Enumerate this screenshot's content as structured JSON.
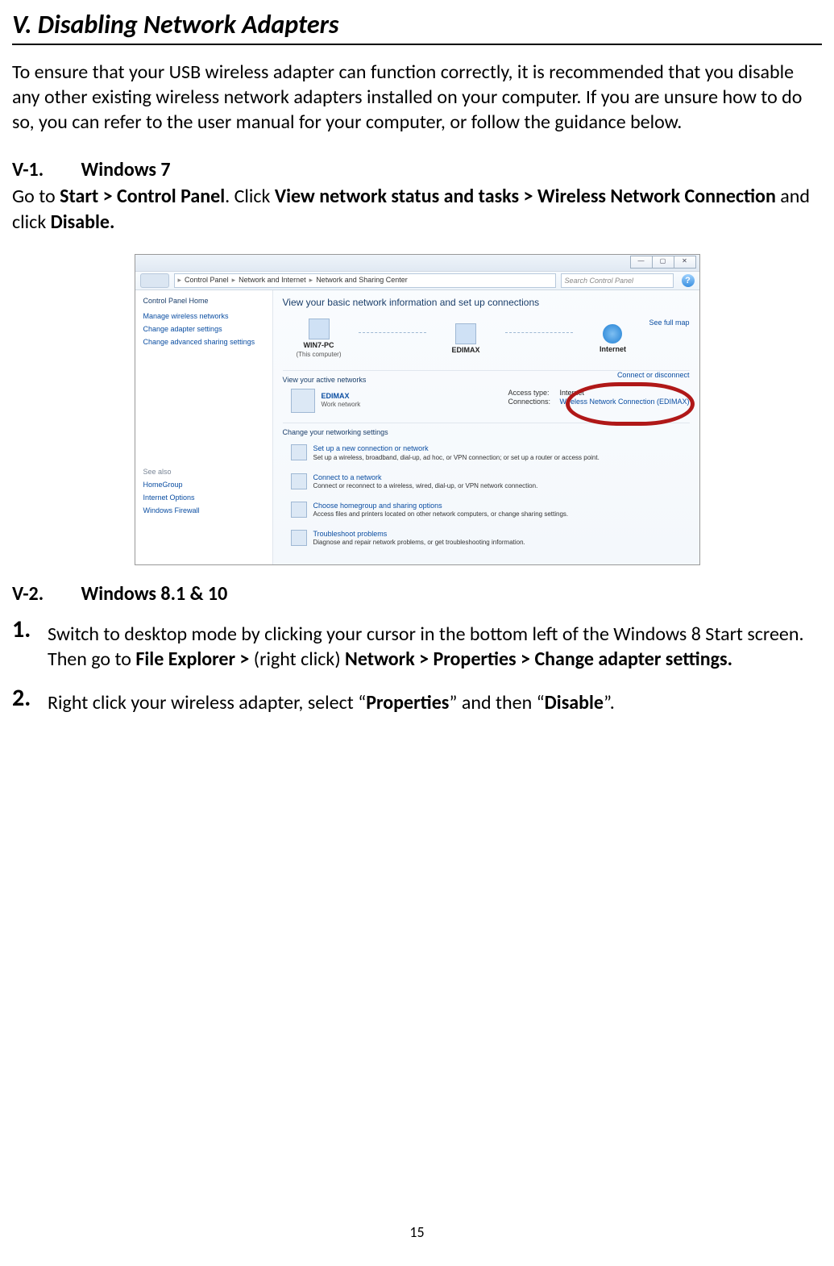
{
  "chapter": {
    "title": "V. Disabling Network Adapters"
  },
  "intro": "To ensure that your USB wireless adapter can function correctly, it is recommended that you disable any other existing wireless network adapters installed on your computer. If you are unsure how to do so, you can refer to the user manual for your computer, or follow the guidance below.",
  "sec1": {
    "num": "V-1.",
    "title": "Windows 7",
    "text_a": "Go to ",
    "bold_a": "Start > Control Panel",
    "text_b": ". Click ",
    "bold_b": "View network status and tasks > Wireless Network Connection",
    "text_c": " and click ",
    "bold_c": "Disable."
  },
  "win7": {
    "window_controls": {
      "min": "—",
      "max": "▢",
      "close": "✕"
    },
    "breadcrumb": {
      "a": "Control Panel",
      "b": "Network and Internet",
      "c": "Network and Sharing Center",
      "sep": "▸"
    },
    "search_placeholder": "Search Control Panel",
    "sidebar": {
      "head": "Control Panel Home",
      "links": [
        "Manage wireless networks",
        "Change adapter settings",
        "Change advanced sharing settings"
      ],
      "see_also_head": "See also",
      "see_also": [
        "HomeGroup",
        "Internet Options",
        "Windows Firewall"
      ]
    },
    "main": {
      "heading": "View your basic network information and set up connections",
      "see_full": "See full map",
      "node1": {
        "name": "WIN7-PC",
        "sub": "(This computer)"
      },
      "node2": {
        "name": "EDIMAX",
        "sub": ""
      },
      "node3": {
        "name": "Internet",
        "sub": ""
      },
      "view_active": "View your active networks",
      "connect_disc": "Connect or disconnect",
      "active": {
        "name": "EDIMAX",
        "type": "Work network",
        "access_label": "Access type:",
        "access_value": "Internet",
        "conn_label": "Connections:",
        "conn_value": "Wireless Network Connection (EDIMAX)"
      },
      "change_settings": "Change your networking settings",
      "items": [
        {
          "title": "Set up a new connection or network",
          "desc": "Set up a wireless, broadband, dial-up, ad hoc, or VPN connection; or set up a router or access point."
        },
        {
          "title": "Connect to a network",
          "desc": "Connect or reconnect to a wireless, wired, dial-up, or VPN network connection."
        },
        {
          "title": "Choose homegroup and sharing options",
          "desc": "Access files and printers located on other network computers, or change sharing settings."
        },
        {
          "title": "Troubleshoot problems",
          "desc": "Diagnose and repair network problems, or get troubleshooting information."
        }
      ]
    }
  },
  "sec2": {
    "num": "V-2.",
    "title": "Windows 8.1 & 10"
  },
  "steps": [
    {
      "num": "1.",
      "pre": "Switch to desktop mode by clicking your cursor in the bottom left of the Windows 8 Start screen. Then go to ",
      "b1": "File Explorer > ",
      "mid": "(right click) ",
      "b2": "Network > Properties > Change adapter settings."
    },
    {
      "num": "2.",
      "pre": "Right click your wireless adapter, select “",
      "b1": "Properties",
      "mid": "” and then “",
      "b2": "Disable",
      "post": "”."
    }
  ],
  "page_number": "15"
}
